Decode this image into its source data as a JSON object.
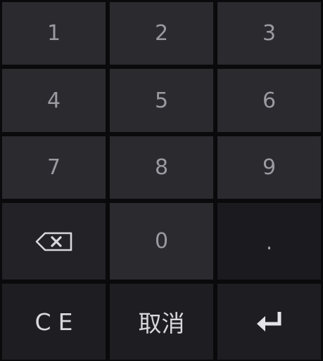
{
  "keypad": {
    "keys": {
      "k1": "1",
      "k2": "2",
      "k3": "3",
      "k4": "4",
      "k5": "5",
      "k6": "6",
      "k7": "7",
      "k8": "8",
      "k9": "9",
      "k0": "0",
      "decimal": ".",
      "ce": "CE",
      "cancel": "取消"
    },
    "icons": {
      "backspace": "backspace-icon",
      "enter": "enter-icon"
    },
    "colors": {
      "background": "#0a0a0c",
      "key": "#2a2a2f",
      "key_dark": "#222227",
      "key_bottom": "#1e1e22",
      "digit_text": "#9a9aa0",
      "action_text": "#d8d8dc"
    }
  }
}
